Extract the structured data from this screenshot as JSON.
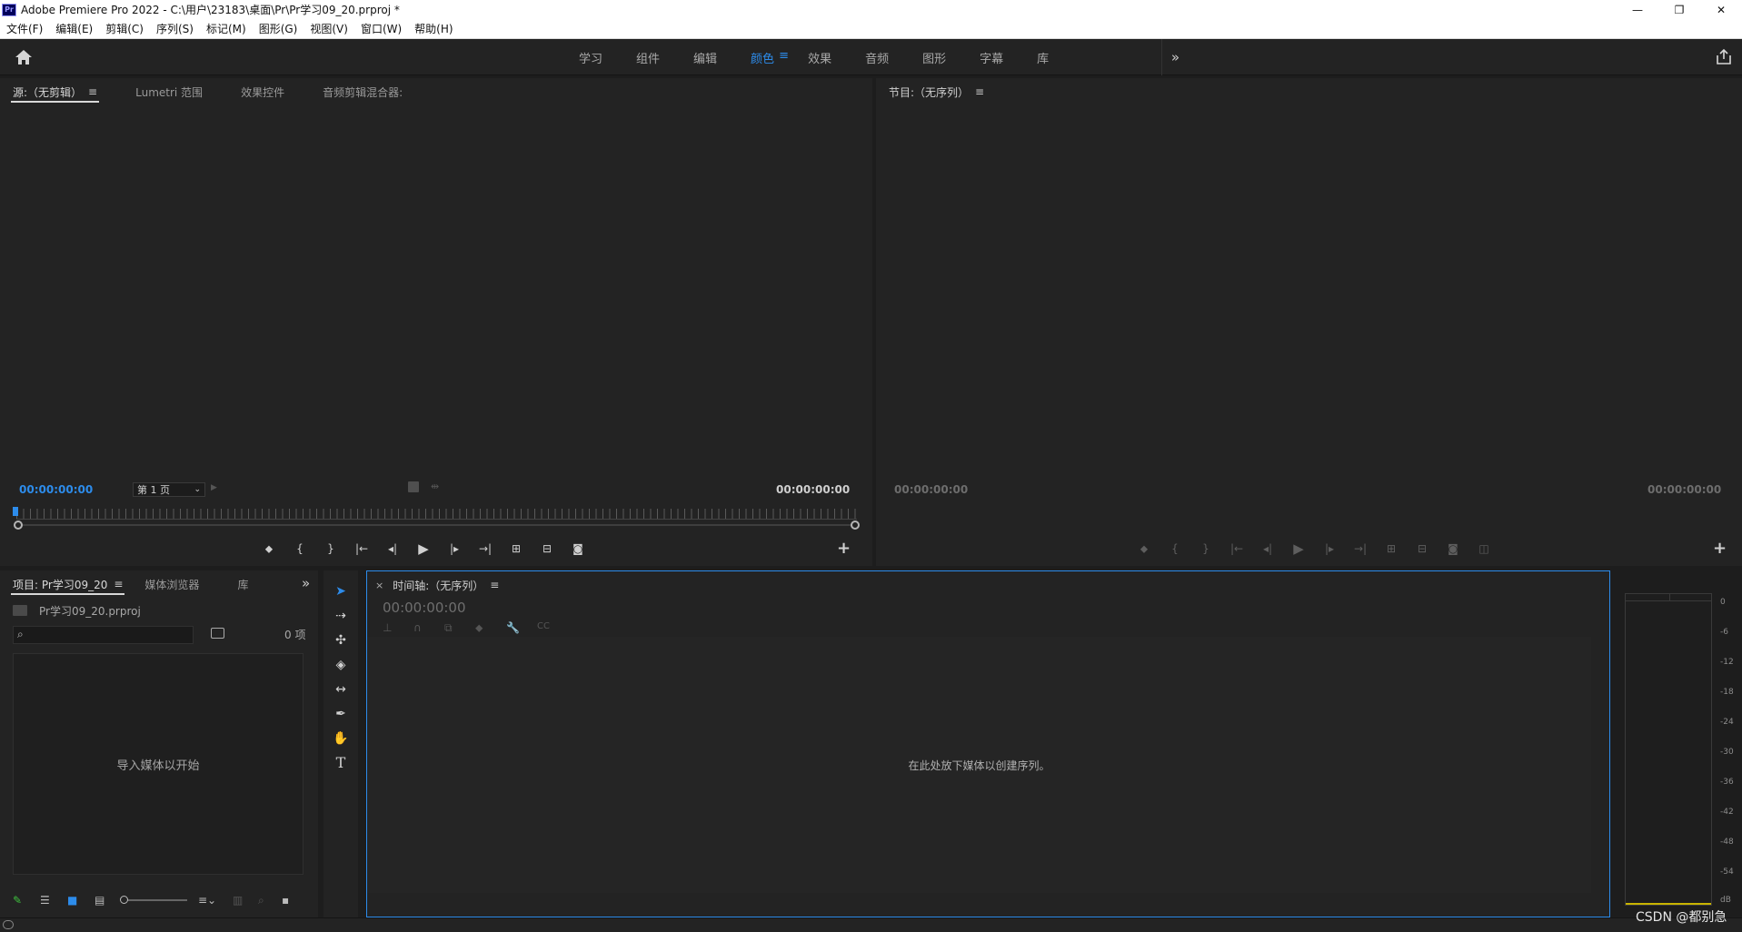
{
  "window": {
    "logo_text": "Pr",
    "title": "Adobe Premiere Pro 2022 - C:\\用户\\23183\\桌面\\Pr\\Pr学习09_20.prproj *",
    "controls": [
      "—",
      "❐",
      "✕"
    ]
  },
  "menu": [
    "文件(F)",
    "编辑(E)",
    "剪辑(C)",
    "序列(S)",
    "标记(M)",
    "图形(G)",
    "视图(V)",
    "窗口(W)",
    "帮助(H)"
  ],
  "workspaces": {
    "tabs": [
      "学习",
      "组件",
      "编辑",
      "颜色",
      "效果",
      "音频",
      "图形",
      "字幕",
      "库"
    ],
    "active": "颜色",
    "menu_glyph": "≡",
    "more": "»"
  },
  "source_panel": {
    "tabs": [
      "源:（无剪辑）",
      "Lumetri 范围",
      "效果控件",
      "音频剪辑混合器:"
    ],
    "menu_glyph": "≡",
    "timecode_left": "00:00:00:00",
    "page_select": "第 1 页",
    "timecode_right": "00:00:00:00"
  },
  "program_panel": {
    "title": "节目:（无序列）",
    "menu_glyph": "≡",
    "timecode_left": "00:00:00:00",
    "timecode_right": "00:00:00:00"
  },
  "project_panel": {
    "tabs": [
      "项目: Pr学习09_20",
      "媒体浏览器",
      "库"
    ],
    "menu_glyph": "≡",
    "more": "»",
    "file_name": "Pr学习09_20.prproj",
    "item_count": "0 项",
    "empty_text": "导入媒体以开始"
  },
  "timeline_panel": {
    "close": "×",
    "title": "时间轴:（无序列）",
    "menu_glyph": "≡",
    "timecode": "00:00:00:00",
    "empty_text": "在此处放下媒体以创建序列。"
  },
  "audio_meter": {
    "scale": [
      "0",
      "-6",
      "-12",
      "-18",
      "-24",
      "-30",
      "-36",
      "-42",
      "-48",
      "-54",
      "dB"
    ]
  },
  "watermark": "CSDN @都别急"
}
